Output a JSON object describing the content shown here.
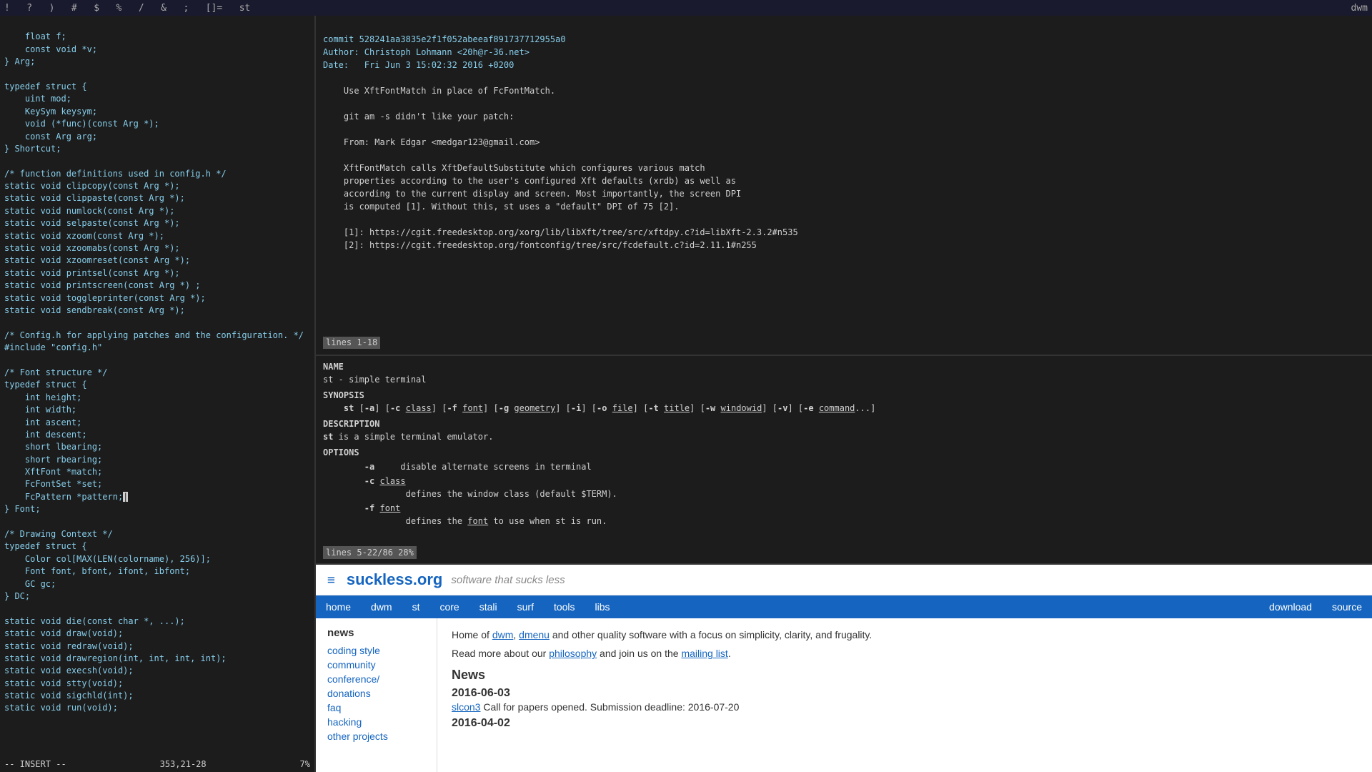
{
  "topbar": {
    "items": [
      "!",
      "?",
      ")",
      "#",
      "$",
      "%",
      "/",
      "&",
      ";",
      "[]=",
      "st"
    ]
  },
  "editor": {
    "lines": [
      "    float f;",
      "    const void *v;",
      "} Arg;",
      "",
      "typedef struct {",
      "    uint mod;",
      "    KeySym keysym;",
      "    void (*func)(const Arg *);",
      "    const Arg arg;",
      "} Shortcut;",
      "",
      "/* function definitions used in config.h */",
      "static void clipcopy(const Arg *);",
      "static void clippaste(const Arg *);",
      "static void numlock(const Arg *);",
      "static void selpaste(const Arg *);",
      "static void xzoom(const Arg *);",
      "static void xzoomabs(const Arg *);",
      "static void xzoomreset(const Arg *);",
      "static void printsel(const Arg *);",
      "static void printscreen(const Arg *) ;",
      "static void toggleprinter(const Arg *);",
      "static void sendbreak(const Arg *);",
      "",
      "/* Config.h for applying patches and the configuration. */",
      "#include \"config.h\"",
      "",
      "/* Font structure */",
      "typedef struct {",
      "    int height;",
      "    int width;",
      "    int ascent;",
      "    int descent;",
      "    short lbearing;",
      "    short rbearing;",
      "    XftFont *match;",
      "    FcFontSet *set;",
      "    FcPattern *pattern;",
      "} Font;",
      "",
      "/* Drawing Context */",
      "typedef struct {",
      "    Color col[MAX(LEN(colorname), 256)];",
      "    Font font, bfont, ifont, ibfont;",
      "    GC gc;",
      "} DC;",
      "",
      "static void die(const char *, ...);",
      "static void draw(void);",
      "static void redraw(void);",
      "static void drawregion(int, int, int, int);",
      "static void execsh(void);",
      "static void stty(void);",
      "static void sigchld(int);",
      "static void run(void);"
    ],
    "cursor_line": "    FcPattern *pattern;|",
    "status": {
      "mode": "-- INSERT --",
      "position": "353,21-28",
      "percent": "7%"
    }
  },
  "git": {
    "commit": "commit 528241aa3835e2f1f052abeeaf891737712955a0",
    "author": "Author: Christoph Lohmann <20h@r-36.net>",
    "date": "Date:   Fri Jun 3 15:02:32 2016 +0200",
    "body": [
      "    Use XftFontMatch in place of FcFontMatch.",
      "",
      "    git am -s didn't like your patch:",
      "",
      "    From: Mark Edgar <medgar123@gmail.com>",
      "",
      "    XftFontMatch calls XftDefaultSubstitute which configures various match",
      "    properties according to the user's configured Xft defaults (xrdb) as well as",
      "    according to the current display and screen. Most importantly, the screen DPI",
      "    is computed [1]. Without this, st uses a \"default\" DPI of 75 [2].",
      "",
      "    [1]: https://cgit.freedesktop.org/xorg/lib/libXft/tree/src/xftdpy.c?id=libXft-2.3.2#n535",
      "    [2]: https://cgit.freedesktop.org/fontconfig/tree/src/fcdefault.c?id=2.11.1#n255"
    ],
    "status_bar": "lines 1-18"
  },
  "man": {
    "name_section": "NAME",
    "name_content": "    st - simple terminal",
    "synopsis_section": "SYNOPSIS",
    "synopsis_content": "    st [-a] [-c class] [-f font] [-g geometry] [-i] [-o file] [-t title] [-w windowid] [-v] [-e command...]",
    "description_section": "DESCRIPTION",
    "description_content": "    st is a simple terminal emulator.",
    "options_section": "OPTIONS",
    "options": [
      {
        "flag": "-a",
        "desc": "    disable alternate screens in terminal"
      },
      {
        "flag": "-c class",
        "desc": "        defines the window class (default $TERM)."
      },
      {
        "flag": "-f font",
        "desc": "        defines the font to use when st is run."
      }
    ],
    "status_bar": "lines 5-22/86 28%"
  },
  "web": {
    "logo": "suckless.org",
    "tagline": "software that sucks less",
    "nav": {
      "items": [
        "home",
        "dwm",
        "st",
        "core",
        "stali",
        "surf",
        "tools",
        "libs"
      ],
      "right_items": [
        "download",
        "source"
      ]
    },
    "sidebar": {
      "title": "news",
      "links": [
        "coding style",
        "community",
        "conference/",
        "donations",
        "faq",
        "hacking",
        "other projects"
      ]
    },
    "main": {
      "intro": "Home of dwm, dmenu and other quality software with a focus on simplicity, clarity, and frugality.",
      "intro2": "Read more about our philosophy and join us on the mailing list.",
      "news_title": "News",
      "entries": [
        {
          "date": "2016-06-03",
          "items": [
            {
              "link": "slcon3",
              "text": " Call for papers opened. Submission deadline: 2016-07-20"
            }
          ]
        },
        {
          "date": "2016-04-02",
          "items": []
        }
      ]
    }
  }
}
